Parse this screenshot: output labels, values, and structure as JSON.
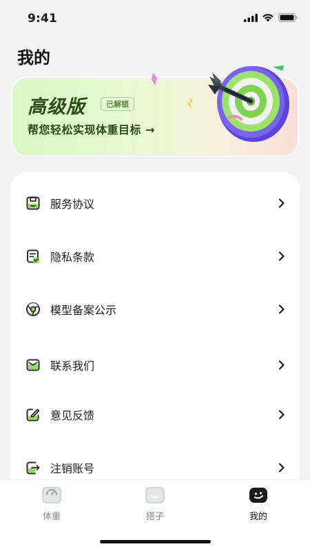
{
  "status_bar": {
    "time": "9:41"
  },
  "page": {
    "title": "我的"
  },
  "premium": {
    "title": "高级版",
    "badge": "已解锁",
    "subtitle": "帮您轻松实现体重目标 →"
  },
  "menu": {
    "items": [
      {
        "label": "服务协议",
        "icon": "document-save-icon"
      },
      {
        "label": "隐私条款",
        "icon": "document-check-icon"
      },
      {
        "label": "模型备案公示",
        "icon": "chrome-circle-icon"
      },
      {
        "label": "联系我们",
        "icon": "mail-icon"
      },
      {
        "label": "意见反馈",
        "icon": "edit-icon"
      },
      {
        "label": "注销账号",
        "icon": "logout-icon"
      }
    ]
  },
  "tabs": [
    {
      "label": "体重",
      "icon": "scale-icon",
      "active": false
    },
    {
      "label": "搭子",
      "icon": "buddy-face-icon",
      "active": false
    },
    {
      "label": "我的",
      "icon": "smile-face-icon",
      "active": true
    }
  ],
  "colors": {
    "accent_green": "#8fdc5f",
    "dark_green_text": "#2c4a16",
    "icon_dark": "#2b2b2b"
  }
}
